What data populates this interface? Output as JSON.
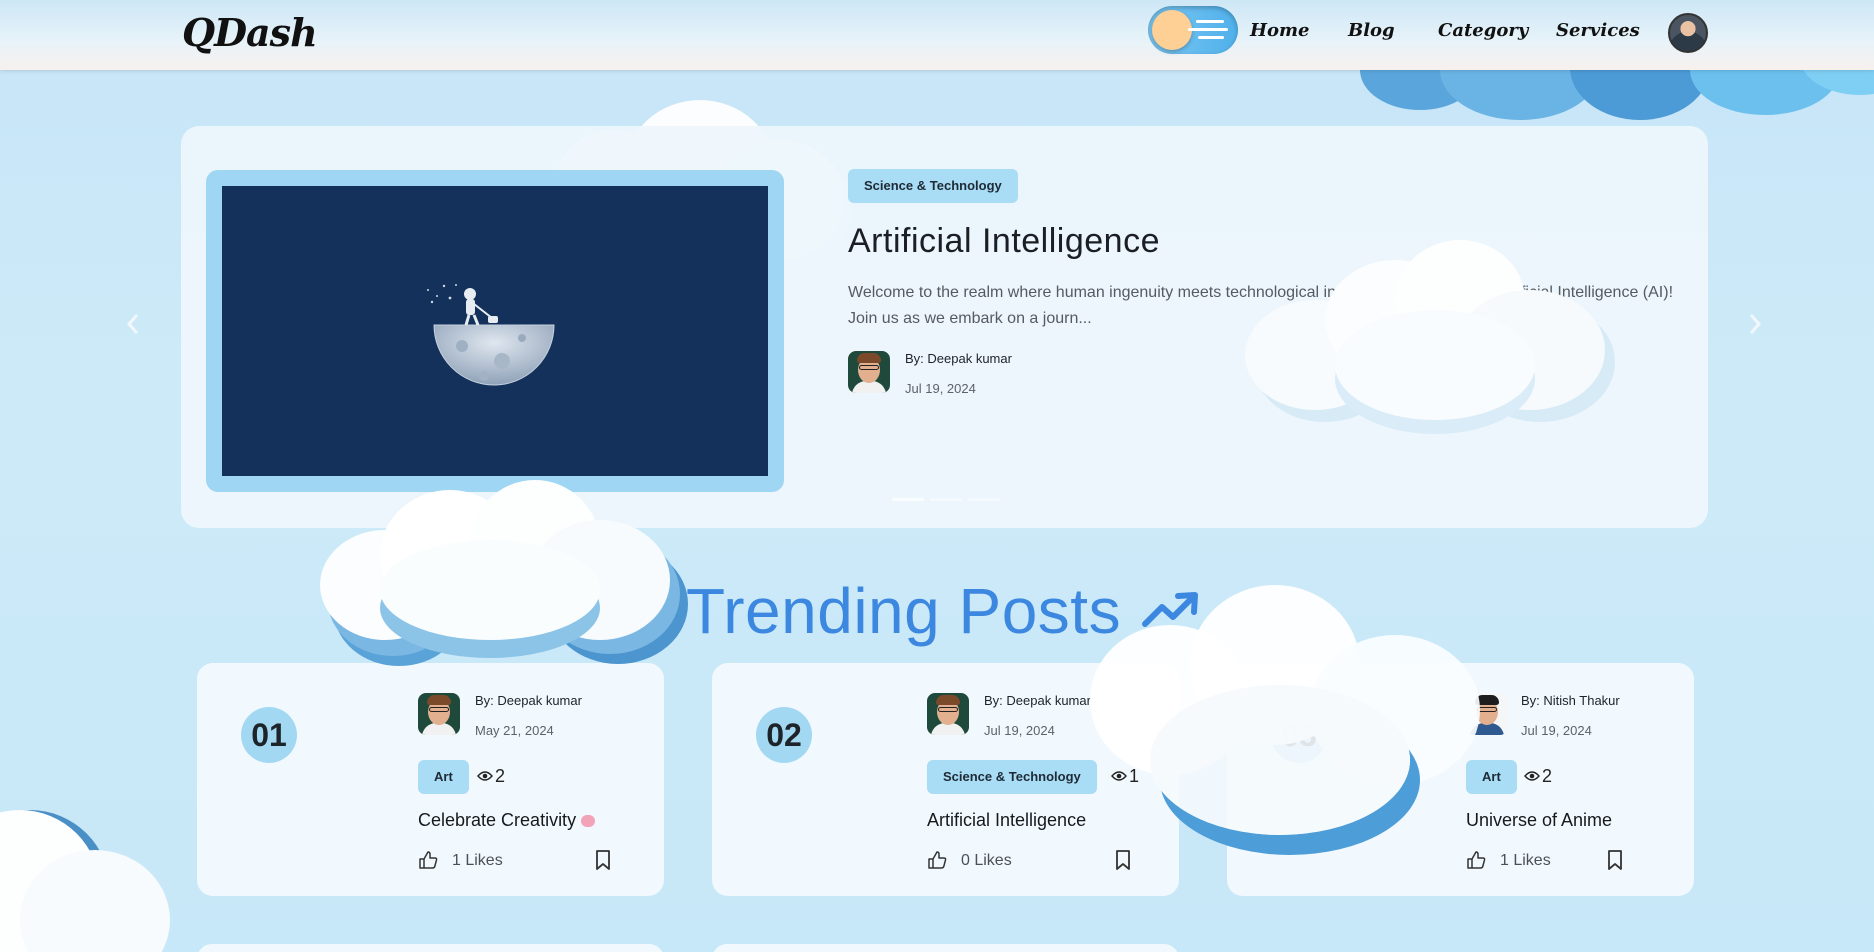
{
  "header": {
    "logo": "QDash",
    "nav": [
      "Home",
      "Blog",
      "Category",
      "Services"
    ]
  },
  "hero": {
    "category": "Science & Technology",
    "title": "Artificial Intelligence",
    "excerpt": "Welcome to the realm where human ingenuity meets technological innovation - the world of Artificial Intelligence (AI)! Join us as we embark on a journ...",
    "author": "By: Deepak kumar",
    "date": "Jul 19, 2024",
    "prev_icon": "chevron-left-icon",
    "next_icon": "chevron-right-icon"
  },
  "trending": {
    "title": "Trending Posts",
    "icon": "trending-up-icon",
    "posts": [
      {
        "rank": "01",
        "author": "By: Deepak kumar",
        "date": "May 21, 2024",
        "category": "Art",
        "views": "2",
        "title": "Celebrate Creativity",
        "likes": "1 Likes"
      },
      {
        "rank": "02",
        "author": "By: Deepak kumar",
        "date": "Jul 19, 2024",
        "category": "Science & Technology",
        "views": "1",
        "title": "Artificial Intelligence",
        "likes": "0 Likes"
      },
      {
        "rank": "03",
        "author": "By: Nitish Thakur",
        "date": "Jul 19, 2024",
        "category": "Art",
        "views": "2",
        "title": "Universe of Anime",
        "likes": "1 Likes"
      }
    ]
  },
  "colors": {
    "accent": "#3c87e0",
    "badge": "#a9dcf5",
    "hero_image_bg": "#13315a"
  }
}
